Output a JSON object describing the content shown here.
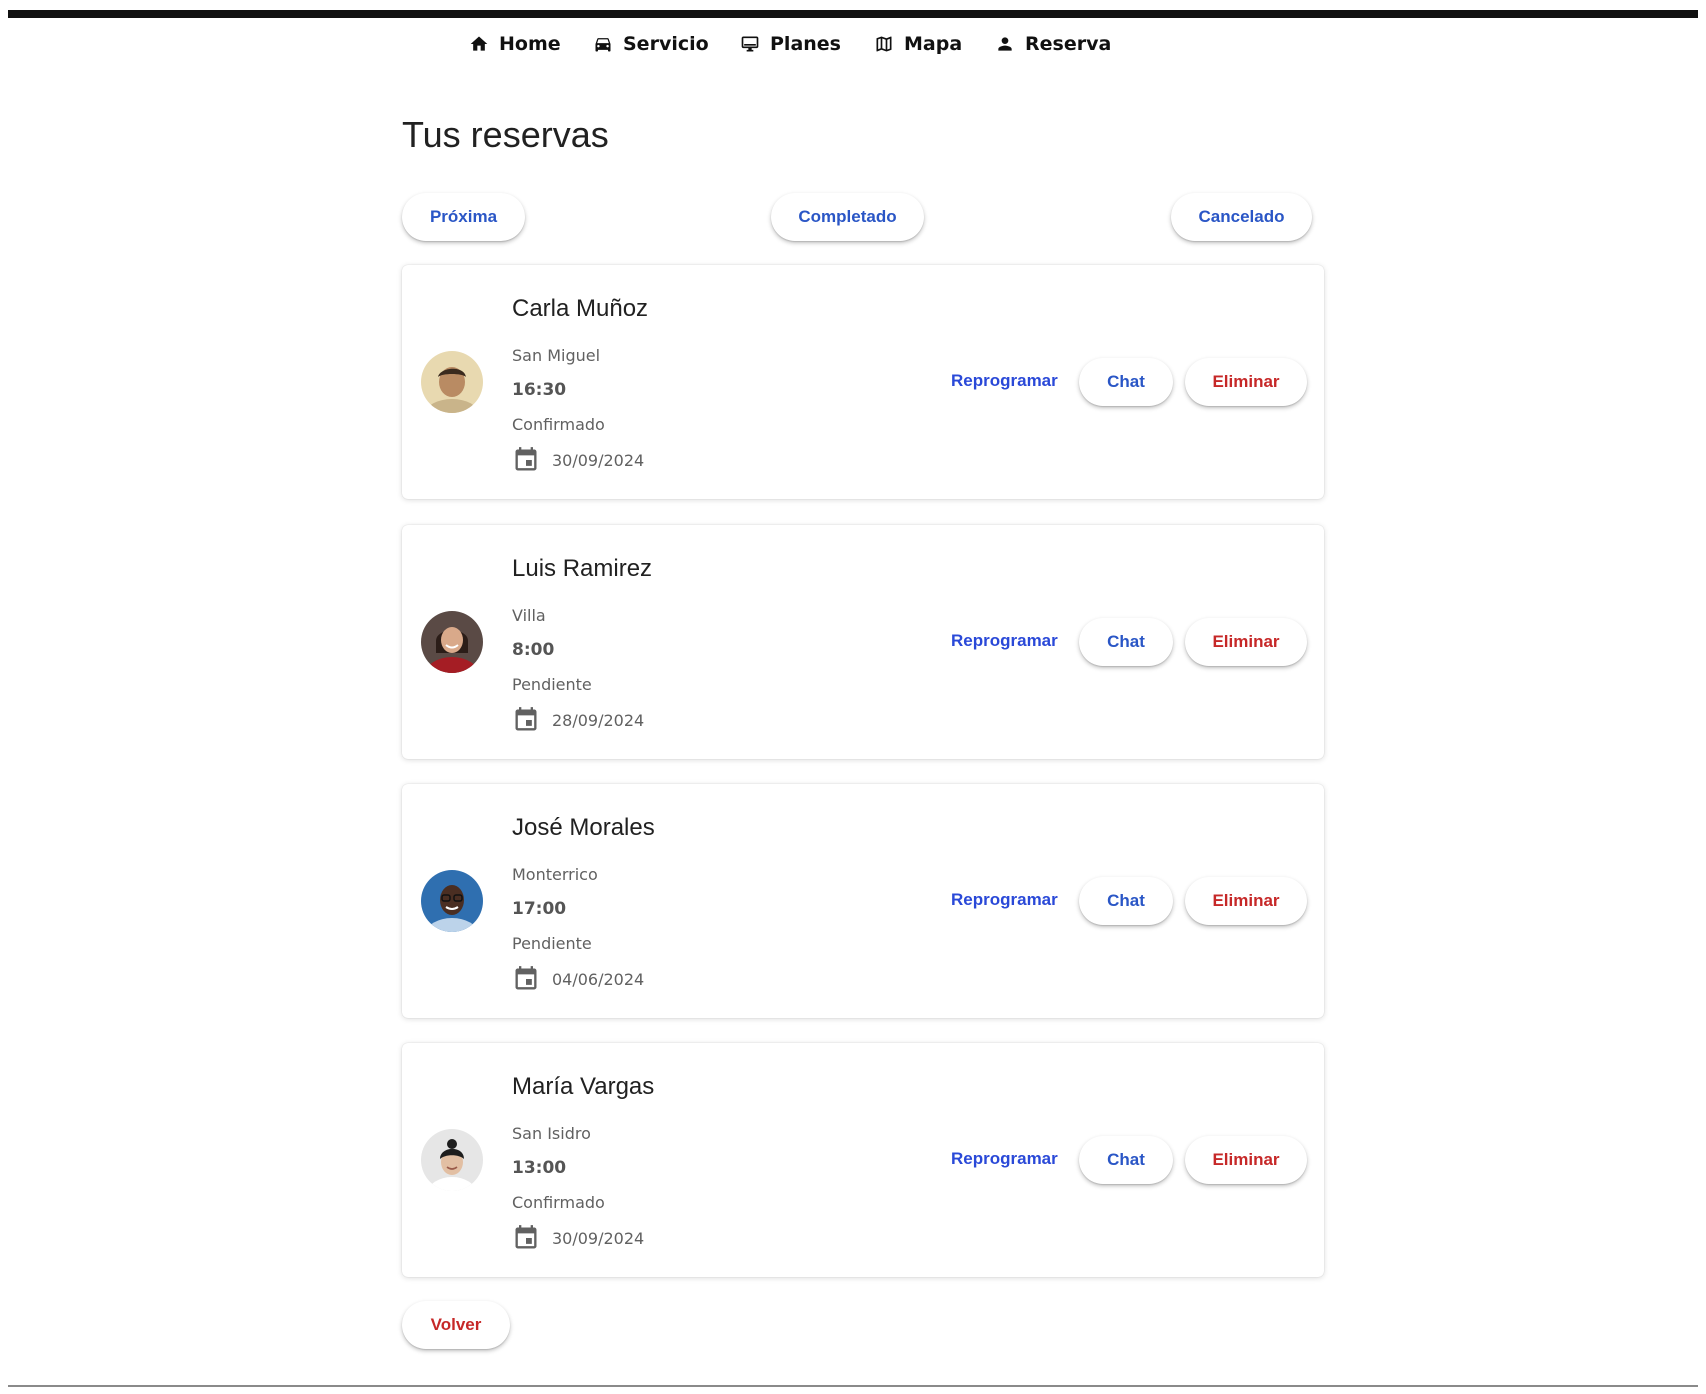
{
  "nav": {
    "items": [
      {
        "label": "Home",
        "icon": "home-icon"
      },
      {
        "label": "Servicio",
        "icon": "car-icon"
      },
      {
        "label": "Planes",
        "icon": "monitor-icon"
      },
      {
        "label": "Mapa",
        "icon": "map-icon"
      },
      {
        "label": "Reserva",
        "icon": "person-icon"
      }
    ]
  },
  "page": {
    "title": "Tus reservas"
  },
  "filters": [
    "Próxima",
    "Completado",
    "Cancelado"
  ],
  "colors": {
    "primary": "#2a56c6",
    "link": "#2a49d8",
    "danger": "#c62828",
    "text": "#212121",
    "muted": "#616161"
  },
  "reservations": [
    {
      "name": "Carla Muñoz",
      "location": "San Miguel",
      "time": "16:30",
      "status": "Confirmado",
      "date": "30/09/2024"
    },
    {
      "name": "Luis Ramirez",
      "location": "Villa",
      "time": "8:00",
      "status": "Pendiente",
      "date": "28/09/2024"
    },
    {
      "name": "José Morales",
      "location": "Monterrico",
      "time": "17:00",
      "status": "Pendiente",
      "date": "04/06/2024"
    },
    {
      "name": "María Vargas",
      "location": "San Isidro",
      "time": "13:00",
      "status": "Confirmado",
      "date": "30/09/2024"
    }
  ],
  "actions": {
    "reprogram": "Reprogramar",
    "chat": "Chat",
    "delete": "Eliminar"
  },
  "footer": {
    "back_label": "Volver"
  }
}
